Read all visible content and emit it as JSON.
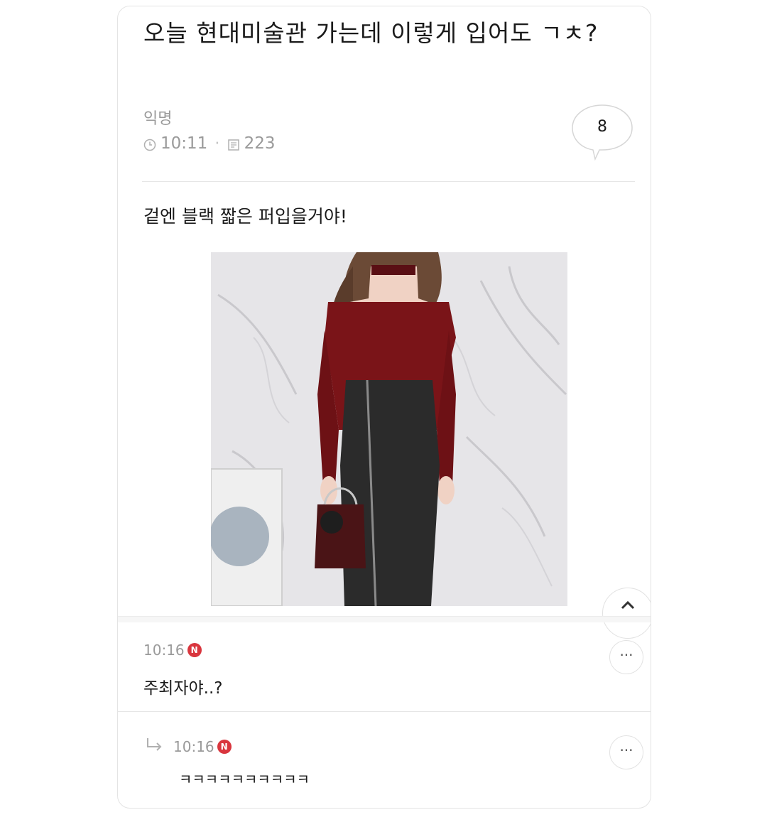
{
  "post": {
    "title": "오늘 현대미술관 가는데 이렇게 입어도 ㄱㅊ?",
    "author": "익명",
    "time": "10:11",
    "views": "223",
    "comment_count": "8",
    "body": "겉엔 블랙 짧은 퍼입을거야!"
  },
  "photo": {
    "icon": "photo-image"
  },
  "comments": [
    {
      "time": "10:16",
      "badge": "N",
      "text": "주최자야..?",
      "more": "···"
    }
  ],
  "replies": [
    {
      "time": "10:16",
      "badge": "N",
      "text": "ㅋㅋㅋㅋㅋㅋㅋㅋㅋㅋ",
      "more": "···"
    }
  ],
  "colors": {
    "badge": "#d9363e",
    "meta": "#9a9a9a",
    "top": "#7a1418",
    "skirt": "#2b2b2b"
  }
}
